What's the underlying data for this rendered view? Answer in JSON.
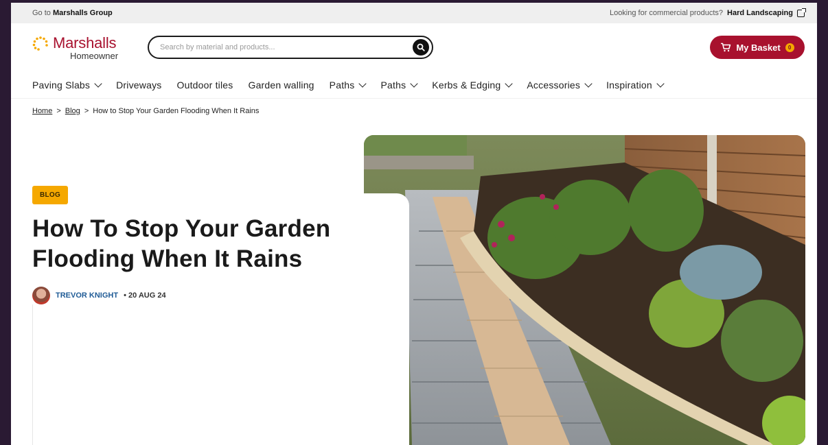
{
  "utility": {
    "left_prefix": "Go to",
    "left_link": "Marshalls Group",
    "right_text": "Looking for commercial products?",
    "right_link": "Hard Landscaping"
  },
  "header": {
    "brand": "Marshalls",
    "brand_sub": "Homeowner",
    "search_placeholder": "Search by material and products...",
    "basket_label": "My Basket",
    "basket_count": "0"
  },
  "nav": {
    "items": [
      {
        "label": "Paving Slabs",
        "has_menu": true
      },
      {
        "label": "Driveways",
        "has_menu": false
      },
      {
        "label": "Outdoor tiles",
        "has_menu": false
      },
      {
        "label": "Garden walling",
        "has_menu": false
      },
      {
        "label": "Paths",
        "has_menu": true
      },
      {
        "label": "Paths",
        "has_menu": true
      },
      {
        "label": "Kerbs & Edging",
        "has_menu": true
      },
      {
        "label": "Accessories",
        "has_menu": true
      },
      {
        "label": "Inspiration",
        "has_menu": true
      }
    ]
  },
  "breadcrumb": {
    "home": "Home",
    "blog": "Blog",
    "current": "How to Stop Your Garden Flooding When It Rains"
  },
  "article": {
    "badge": "BLOG",
    "title": "How To Stop Your Garden Flooding When It Rains",
    "author": "TREVOR KNIGHT",
    "date": "• 20 AUG 24"
  },
  "colors": {
    "brand_red": "#a8112e",
    "badge_yellow": "#f5a800",
    "author_blue": "#1f5b96"
  }
}
